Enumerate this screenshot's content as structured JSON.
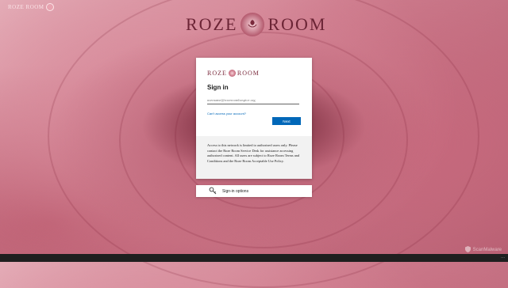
{
  "brand": {
    "left_word": "ROZE",
    "right_word": "ROOM",
    "small_label": "ROZE ROOM"
  },
  "card": {
    "title": "Sign in",
    "username_placeholder": "username@rozeroomhospice.org",
    "cant_access_link": "Can't access your account?",
    "next_button": "Next",
    "notice": "Access to this network is limited to authorized users only. Please contact the Roze Room Service Desk for assistance accessing authorized content. All users are subject to Roze Room Terms and Conditions and the Roze Room Acceptable Use Policy."
  },
  "signin_options": {
    "label": "Sign-in options",
    "icon": "key-search-icon"
  },
  "watermark": {
    "text": "ScanMalware",
    "icon": "shield-icon"
  },
  "bottom_bar": {
    "more": "..."
  },
  "colors": {
    "next_button": "#0067b8",
    "link": "#0067b8",
    "brand_dark": "#6b2435"
  }
}
